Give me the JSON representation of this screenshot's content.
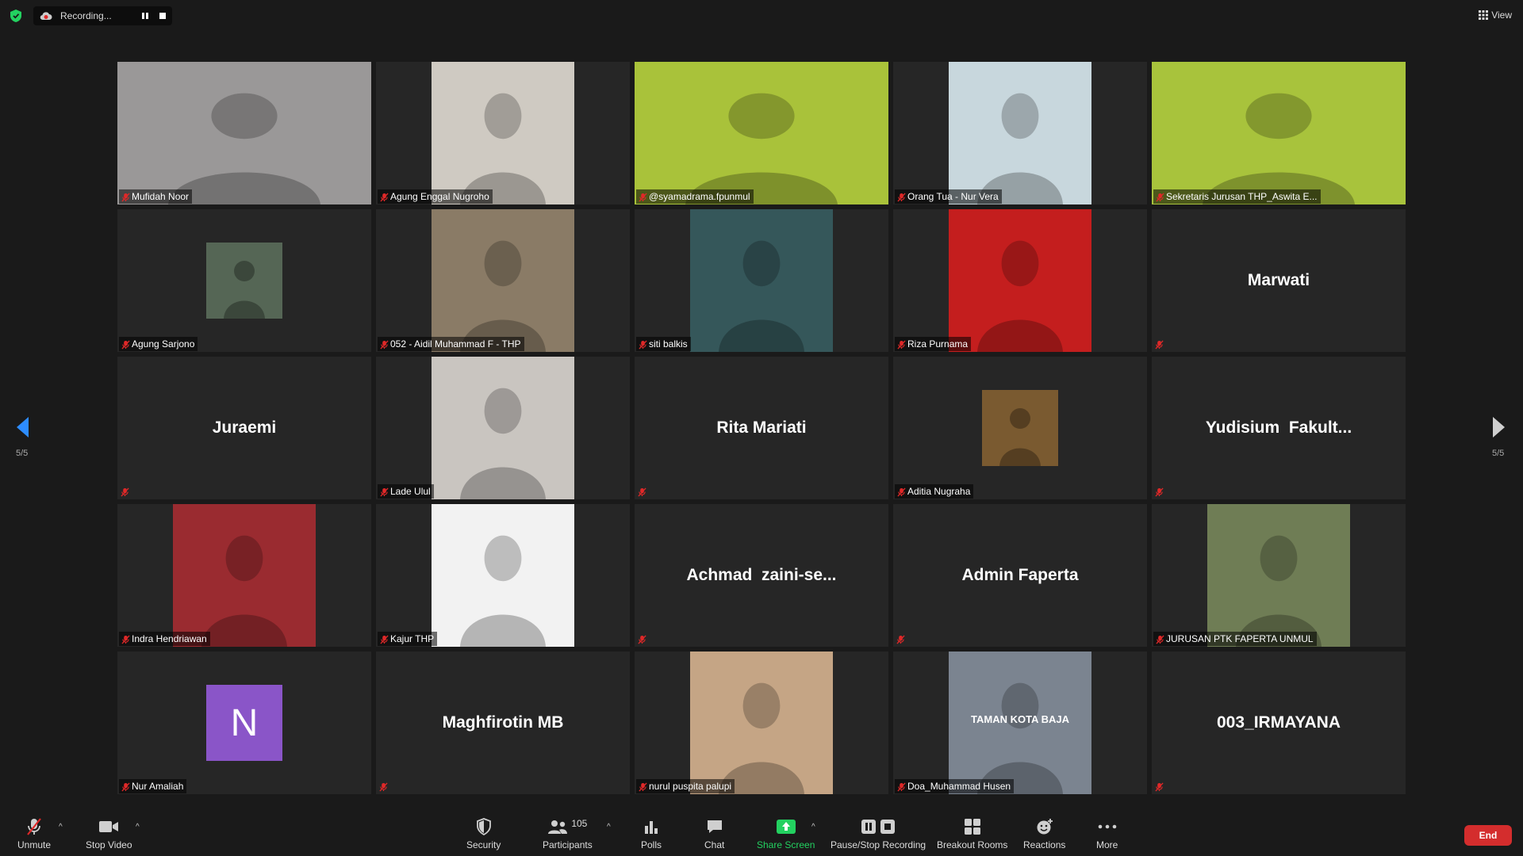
{
  "recording": {
    "label": "Recording..."
  },
  "view_label": "View",
  "page_indicator": "5/5",
  "tiles": [
    {
      "name": "Mufidah Noor",
      "kind": "video-full",
      "bg": "#9a9898"
    },
    {
      "name": "Agung Enggal Nugroho",
      "kind": "video",
      "bg": "#cfcac2"
    },
    {
      "name": "@syamadrama.fpunmul",
      "kind": "video-full",
      "bg": "#a9c23a"
    },
    {
      "name": "Orang Tua - Nur Vera",
      "kind": "video",
      "bg": "#c8d7dd"
    },
    {
      "name": "Sekretaris Jurusan THP_Aswita E...",
      "kind": "video-full",
      "bg": "#a8c33c"
    },
    {
      "name": "Agung Sarjono",
      "kind": "avatar",
      "bg": "#556655"
    },
    {
      "name": "052 - Aidil Muhammad F - THP",
      "kind": "video",
      "bg": "#8a7b66"
    },
    {
      "name": "siti balkis",
      "kind": "video",
      "bg": "#35575a"
    },
    {
      "name": "Riza Purnama",
      "kind": "video",
      "bg": "#c41e1e"
    },
    {
      "name": "",
      "kind": "name",
      "display": "Marwati"
    },
    {
      "name": "",
      "kind": "name",
      "display": "Juraemi"
    },
    {
      "name": "Lade Ulul",
      "kind": "video",
      "bg": "#c9c5c0"
    },
    {
      "name": "",
      "kind": "name",
      "display": "Rita Mariati"
    },
    {
      "name": "Aditia Nugraha",
      "kind": "avatar",
      "bg": "#7a5a30"
    },
    {
      "name": "",
      "kind": "name",
      "display": "Yudisium  Fakult..."
    },
    {
      "name": "Indra Hendriawan",
      "kind": "video",
      "bg": "#9a2b30"
    },
    {
      "name": "Kajur THP",
      "kind": "video",
      "bg": "#f2f2f2"
    },
    {
      "name": "",
      "kind": "name",
      "display": "Achmad  zaini-se..."
    },
    {
      "name": "",
      "kind": "name",
      "display": "Admin Faperta"
    },
    {
      "name": "JURUSAN PTK FAPERTA UNMUL",
      "kind": "video",
      "bg": "#6f7d55"
    },
    {
      "name": "Nur Amaliah",
      "kind": "letter",
      "letter": "N",
      "bg": "#8a55c8"
    },
    {
      "name": "",
      "kind": "name",
      "display": "Maghfirotin MB"
    },
    {
      "name": "nurul puspita palupi",
      "kind": "video",
      "bg": "#c5a585"
    },
    {
      "name": "Doa_Muhammad Husen",
      "kind": "video",
      "bg": "#7b8490",
      "overlay": "TAMAN KOTA BAJA"
    },
    {
      "name": "",
      "kind": "name",
      "display": "003_IRMAYANA"
    }
  ],
  "toolbar": {
    "unmute": "Unmute",
    "stop_video": "Stop Video",
    "security": "Security",
    "participants": "Participants",
    "participants_count": "105",
    "polls": "Polls",
    "chat": "Chat",
    "share_screen": "Share Screen",
    "pause_recording": "Pause/Stop Recording",
    "breakout_rooms": "Breakout Rooms",
    "reactions": "Reactions",
    "more": "More",
    "end": "End"
  },
  "colors": {
    "accent_green": "#23d160",
    "end_red": "#d42d2d",
    "nav_blue": "#2d8cff",
    "mute_red": "#e02828"
  }
}
